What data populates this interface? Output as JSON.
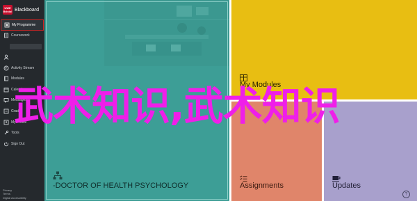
{
  "brand": {
    "logo_text": "UWE Bristol",
    "name": "Blackboard"
  },
  "sidebar": {
    "items": [
      {
        "label": "My Programme",
        "icon": "programme-icon"
      },
      {
        "label": "Coursework",
        "icon": "coursework-icon"
      },
      {
        "label": "Activity Stream",
        "icon": "activity-icon"
      },
      {
        "label": "Modules",
        "icon": "modules-icon"
      },
      {
        "label": "Calendar",
        "icon": "calendar-icon"
      },
      {
        "label": "Messages",
        "icon": "messages-icon"
      },
      {
        "label": "Grades",
        "icon": "grades-icon"
      },
      {
        "label": "My Profile",
        "icon": "profile-icon"
      },
      {
        "label": "Tools",
        "icon": "tools-icon"
      },
      {
        "label": "Sign Out",
        "icon": "signout-icon"
      }
    ],
    "footer": [
      "Privacy",
      "Terms",
      "Digital Accessibility"
    ]
  },
  "tiles": {
    "psychology": {
      "label": "-DOCTOR OF HEALTH PSYCHOLOGY",
      "color": "#3d9e96"
    },
    "modules": {
      "label": "My Modules",
      "color": "#e8be12"
    },
    "assignments": {
      "label": "Assignments",
      "color": "#e0856a"
    },
    "updates": {
      "label": "Updates",
      "color": "#a8a0cc"
    }
  },
  "watermark": {
    "text": "武术知识,武术知识",
    "color": "#ef1fe9"
  }
}
